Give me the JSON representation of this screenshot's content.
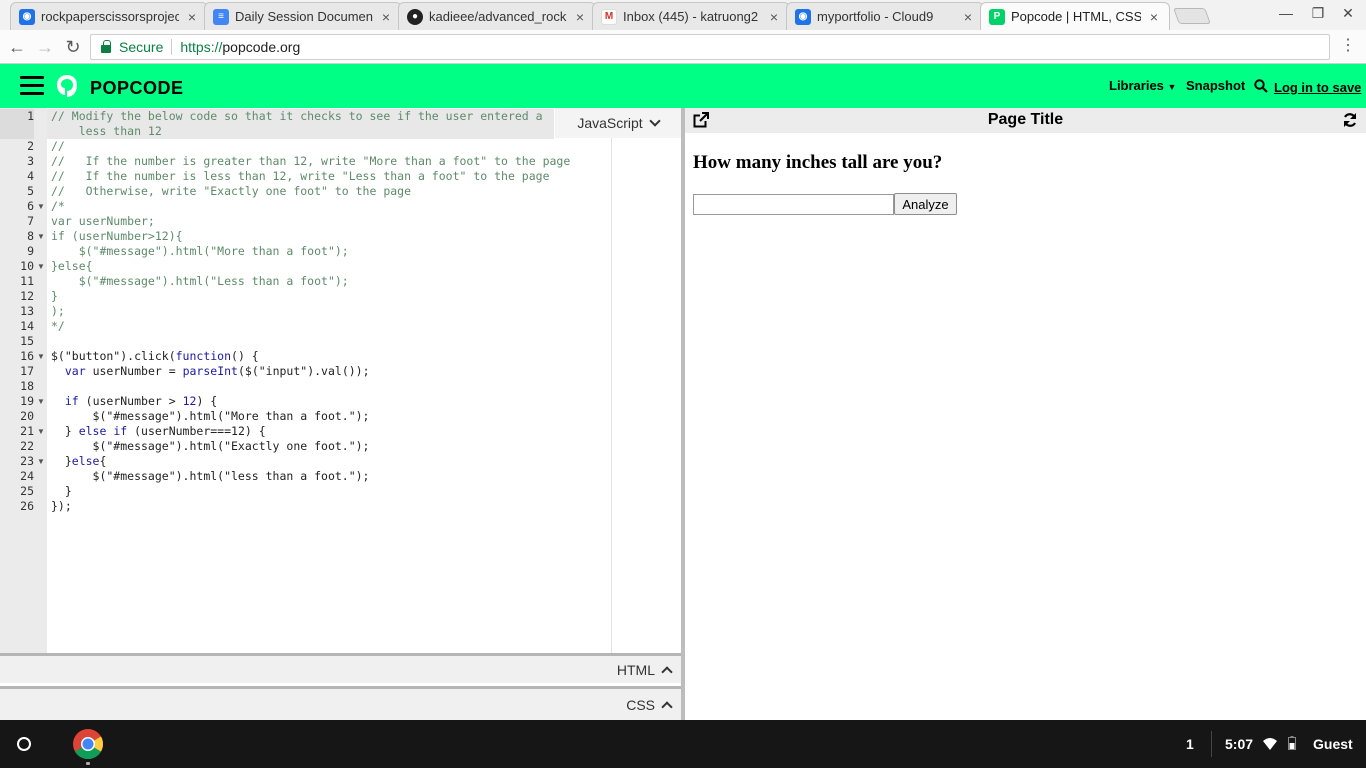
{
  "browser": {
    "tabs": [
      {
        "title": "rockpaperscissorsprojec",
        "favicon": "cloud9-icon",
        "color": "#1e73e8"
      },
      {
        "title": "Daily Session Document",
        "favicon": "docs-icon",
        "color": "#4285f4"
      },
      {
        "title": "kadieee/advanced_rockp",
        "favicon": "github-icon",
        "color": "#222222"
      },
      {
        "title": "Inbox (445) - katruong2",
        "favicon": "gmail-icon",
        "color": "#d93025"
      },
      {
        "title": "myportfolio - Cloud9",
        "favicon": "cloud9-icon",
        "color": "#1e73e8"
      },
      {
        "title": "Popcode | HTML, CSS, ar",
        "favicon": "popcode-icon",
        "color": "#00d26a"
      }
    ],
    "close_glyph": "×",
    "secure_label": "Secure",
    "url_proto": "https://",
    "url_host": "popcode.org"
  },
  "app": {
    "brand": "POPCODE",
    "brand_color": "#00ff85",
    "libraries_label": "Libraries",
    "snapshot_label": "Snapshot",
    "login_label": "Log in to save"
  },
  "editor": {
    "language_label": "JavaScript",
    "html_label": "HTML",
    "css_label": "CSS",
    "line_numbers": [
      "1",
      "2",
      "3",
      "4",
      "5",
      "6",
      "7",
      "8",
      "9",
      "10",
      "11",
      "12",
      "13",
      "14",
      "15",
      "16",
      "17",
      "18",
      "19",
      "20",
      "21",
      "22",
      "23",
      "24",
      "25",
      "26"
    ],
    "lines": {
      "l1a": "// Modify the below code so that it checks to see if the user entered a",
      "l1b": "    less than 12",
      "l2": "//",
      "l3": "//   If the number is greater than 12, write \"More than a foot\" to the page",
      "l4": "//   If the number is less than 12, write \"Less than a foot\" to the page",
      "l5": "//   Otherwise, write \"Exactly one foot\" to the page",
      "l6": "/*",
      "l7": "var userNumber;",
      "l8": "if (userNumber>12){",
      "l9": "    $(\"#message\").html(\"More than a foot\");",
      "l10": "}else{",
      "l11": "    $(\"#message\").html(\"Less than a foot\");",
      "l12": "}",
      "l13": ");",
      "l14": "*/",
      "l16a": "$(\"button\").click(",
      "l16b": "function",
      "l16c": "() {",
      "l17a": "  ",
      "l17b": "var",
      "l17c": " userNumber = ",
      "l17d": "parseInt",
      "l17e": "($(\"input\").val());",
      "l19a": "  ",
      "l19b": "if",
      "l19c": " (userNumber > ",
      "l19d": "12",
      "l19e": ") {",
      "l20": "      $(\"#message\").html(\"More than a foot.\");",
      "l21a": "  } ",
      "l21b": "else if",
      "l21c": " (userNumber===12) {",
      "l22": "      $(\"#message\").html(\"Exactly one foot.\");",
      "l23a": "  }",
      "l23b": "else",
      "l23c": "{",
      "l24": "      $(\"#message\").html(\"less than a foot.\");",
      "l25": "  }",
      "l26": "});"
    }
  },
  "preview": {
    "page_title": "Page Title",
    "heading": "How many inches tall are you?",
    "input_value": "",
    "button_label": "Analyze"
  },
  "shelf": {
    "notification_count": "1",
    "time": "5:07",
    "user": "Guest"
  }
}
